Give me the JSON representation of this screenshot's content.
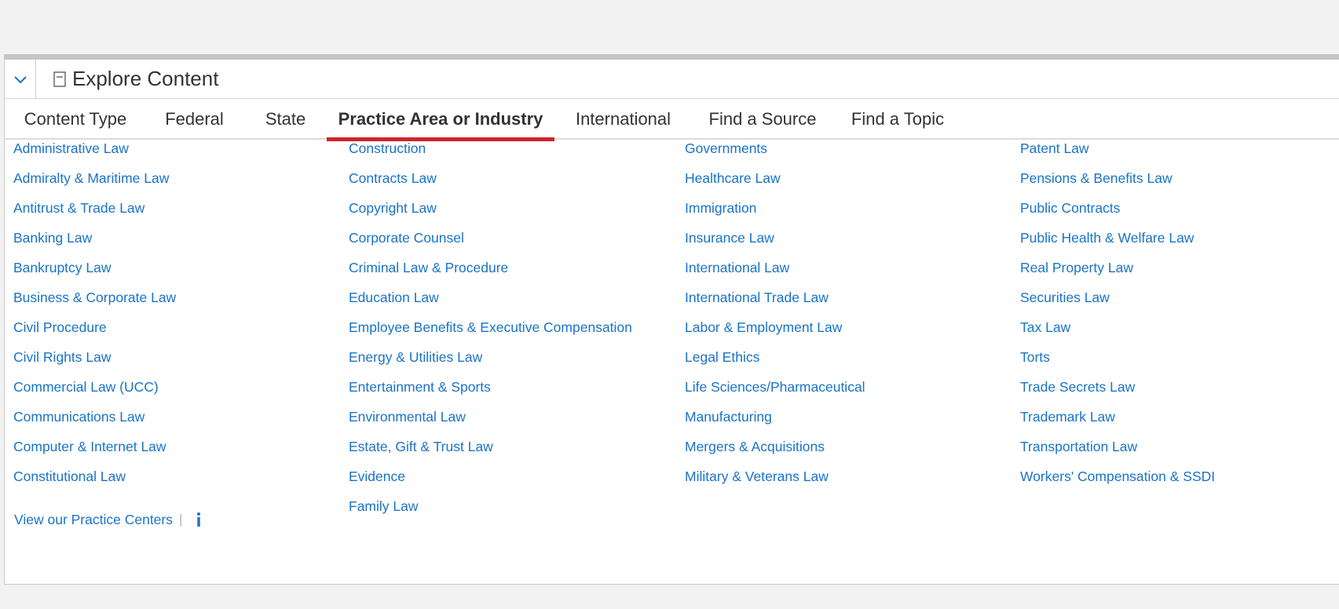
{
  "header": {
    "title": "Explore Content"
  },
  "tabs": [
    {
      "label": "Content Type"
    },
    {
      "label": "Federal"
    },
    {
      "label": "State"
    },
    {
      "label": "Practice Area or Industry",
      "active": true
    },
    {
      "label": "International"
    },
    {
      "label": "Find a Source"
    },
    {
      "label": "Find a Topic"
    }
  ],
  "columns": [
    [
      "Administrative Law",
      "Admiralty & Maritime Law",
      "Antitrust & Trade Law",
      "Banking Law",
      "Bankruptcy Law",
      "Business & Corporate Law",
      "Civil Procedure",
      "Civil Rights Law",
      "Commercial Law (UCC)",
      "Communications Law",
      "Computer & Internet Law",
      "Constitutional Law"
    ],
    [
      "Construction",
      "Contracts Law",
      "Copyright Law",
      "Corporate Counsel",
      "Criminal Law & Procedure",
      "Education Law",
      "Employee Benefits & Executive Compensation",
      "Energy & Utilities Law",
      "Entertainment & Sports",
      "Environmental Law",
      "Estate, Gift & Trust Law",
      "Evidence",
      "Family Law"
    ],
    [
      "Governments",
      "Healthcare Law",
      "Immigration",
      "Insurance Law",
      "International Law",
      "International Trade Law",
      "Labor & Employment Law",
      "Legal Ethics",
      "Life Sciences/Pharmaceutical",
      "Manufacturing",
      "Mergers & Acquisitions",
      "Military & Veterans Law"
    ],
    [
      "Patent Law",
      "Pensions & Benefits Law",
      "Public Contracts",
      "Public Health & Welfare Law",
      "Real Property Law",
      "Securities Law",
      "Tax Law",
      "Torts",
      "Trade Secrets Law",
      "Trademark Law",
      "Transportation Law",
      "Workers' Compensation & SSDI"
    ]
  ],
  "footer": {
    "practice_centers_label": "View our Practice Centers",
    "separator": "|",
    "info_icon": "info-icon"
  },
  "colors": {
    "link": "#1a73c8",
    "active_tab_underline": "#d2232a",
    "topbar": "#c3c5c7"
  }
}
